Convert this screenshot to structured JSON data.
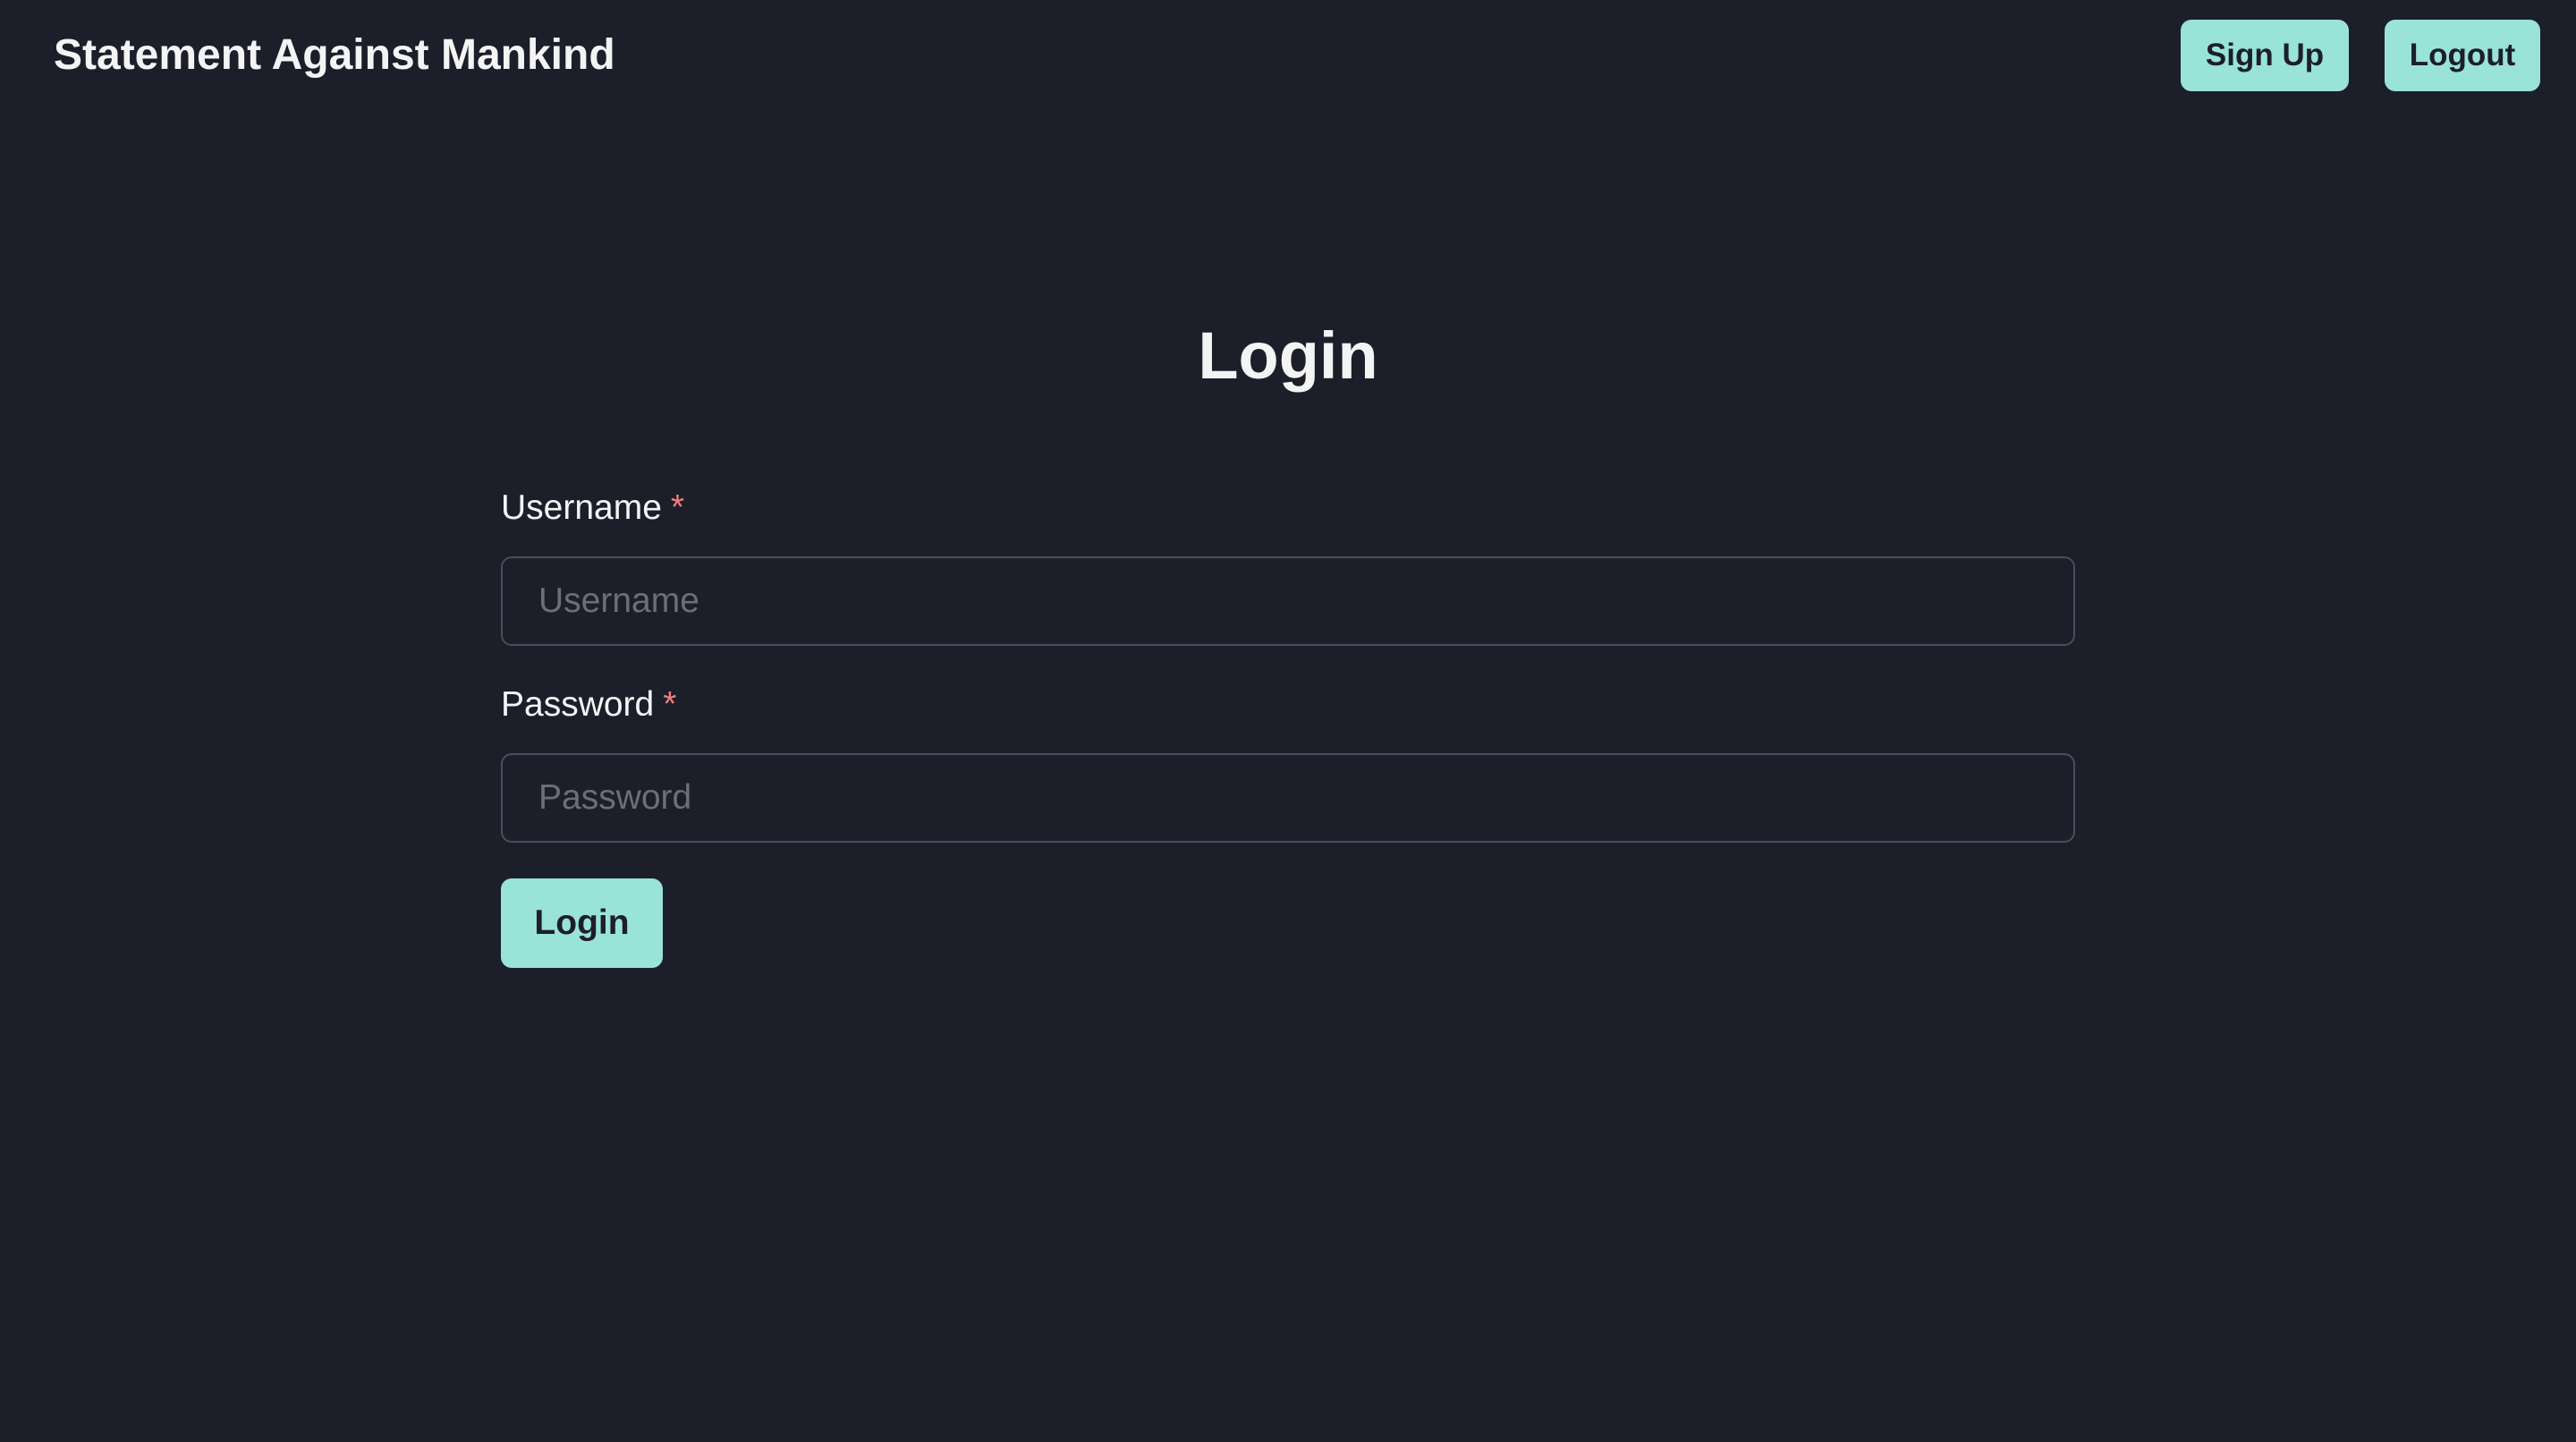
{
  "header": {
    "brand": "Statement Against Mankind",
    "signup_label": "Sign Up",
    "logout_label": "Logout"
  },
  "main": {
    "title": "Login",
    "form": {
      "username": {
        "label": "Username",
        "required_mark": "*",
        "placeholder": "Username",
        "value": ""
      },
      "password": {
        "label": "Password",
        "required_mark": "*",
        "placeholder": "Password",
        "value": ""
      },
      "submit_label": "Login"
    }
  },
  "colors": {
    "background": "#1c1f2a",
    "accent": "#99e3d8",
    "required": "#f07f7f",
    "input_border": "#4a4e5a",
    "placeholder": "#6b6f7a"
  }
}
